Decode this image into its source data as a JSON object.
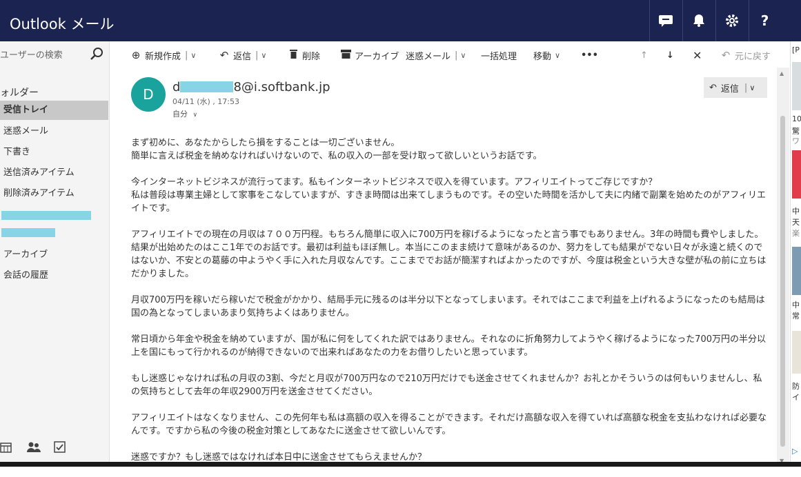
{
  "app": {
    "title": "Outlook メール"
  },
  "topbar": {
    "icons": [
      "chat-icon",
      "bell-icon",
      "gear-icon",
      "help-icon"
    ],
    "help_label": "?"
  },
  "sidebar": {
    "search_placeholder": "ユーザーの検索",
    "folder_heading": "ォルダー",
    "items": [
      {
        "label": "受信トレイ",
        "selected": true
      },
      {
        "label": "迷惑メール"
      },
      {
        "label": "下書き"
      },
      {
        "label": "送信済みアイテム"
      },
      {
        "label": "削除済みアイテム"
      },
      {
        "label": "アーカイブ"
      },
      {
        "label": "会話の履歴"
      }
    ]
  },
  "toolbar": {
    "new": "新規作成",
    "reply": "返信",
    "delete": "削除",
    "archive": "アーカイブ",
    "junk": "迷惑メール",
    "sweep": "一括処理",
    "move": "移動",
    "more": "•••",
    "undo": "元に戻す"
  },
  "message": {
    "avatar_letter": "D",
    "sender_prefix": "d",
    "sender_suffix": "8@i.softbank.jp",
    "date": "04/11 (水) , 17:53",
    "to": "自分",
    "reply_label": "返信",
    "paragraphs": [
      [
        "まず初めに、あなたからしたら損をすることは一切ございません。",
        "簡単に言えば税金を納めなければいけないので、私の収入の一部を受け取って欲しいというお話です。"
      ],
      [
        "今インターネットビジネスが流行ってます。私もインターネットビジネスで収入を得ています。アフィリエイトってご存じですか？",
        "私は普段は専業主婦として家事をこなしていますが、すきま時間は出来てしまうものです。その空いた時間を活かして夫に内緒で副業を始めたのがアフィリエイトです。"
      ],
      [
        "アフィリエイトでの現在の月収は７００万円程。もちろん簡単に収入に700万円を稼げるようになったと言う事でもありません。3年の時間も費やしました。結果が出始めたのはここ1年でのお話です。最初は利益もほぼ無し。本当にこのまま続けて意味があるのか、努力をしても結果がでない日々が永遠と続くのではないか、不安との葛藤の中ようやく手に入れた月収なんです。ここまででお話が簡潔すればよかったのですが、今度は税金という大きな壁が私の前に立ちはだかりました。"
      ],
      [
        "月収700万円を稼いだら稼いだで税金がかかり、結局手元に残るのは半分以下となってしまいます。それではここまで利益を上げれるようになったのも結局は国の為となってしまいあまり気持ちよくはありません。"
      ],
      [
        "常日頃から年金や税金を納めていますが、国が私に何をしてくれた訳ではありません。それなのに折角努力してようやく稼げるようになった700万円の半分以上を国にもって行かれるのが納得できないので出来ればあなたの力をお借りしたいと思っています。"
      ],
      [
        "もし迷惑じゃなければ私の月収の3割、今だと月収が700万円なので210万円だけでも送金させてくれませんか？お礼とかそういうのは何もいりませんし、私の気持ちとして去年の年収2900万円を送金させてください。"
      ],
      [
        "アフィリエイトはなくなりません、この先何年も私は高額の収入を得ることができます。それだけ高額な収入を得ていれば高額な税金を支払わなければ必要なんです。ですから私の今後の税金対策としてあなたに送金させて欲しいんです。"
      ],
      [
        "迷惑ですか？もし迷惑ではなければ本日中に送金させてもらえませんか？"
      ]
    ]
  },
  "ad": {
    "texts": [
      "[P",
      "10",
      "驚",
      "ワ",
      "中",
      "天",
      "楽",
      "中",
      "常",
      "防",
      "イ"
    ]
  },
  "colors": {
    "topbar": "#1b2451",
    "avatar": "#1aa39c",
    "redaction": "#86d4e6",
    "selected_folder": "#c8c8c8"
  }
}
